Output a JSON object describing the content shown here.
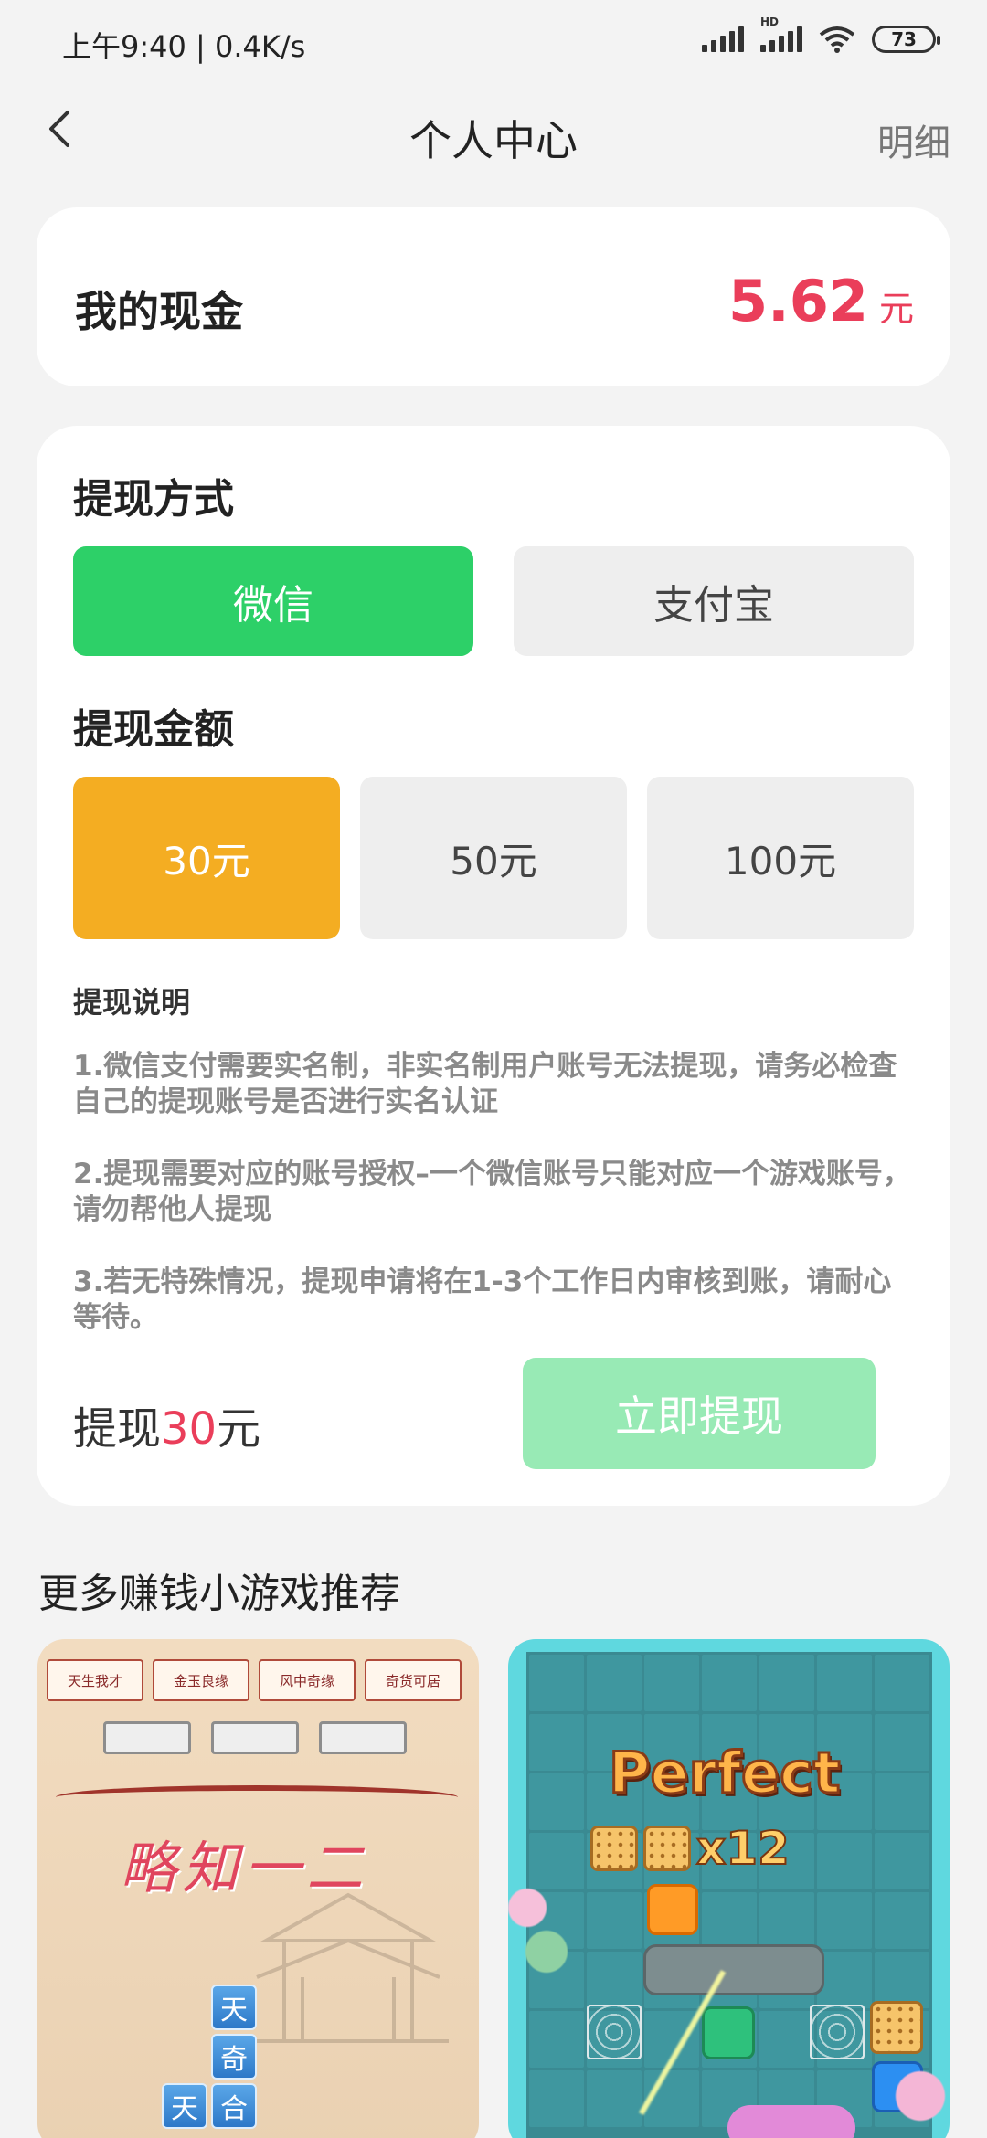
{
  "status_bar": {
    "time": "上午9:40 | 0.4K/s",
    "hd_label": "HD",
    "battery": "73"
  },
  "nav": {
    "title": "个人中心",
    "detail_link": "明细"
  },
  "cash": {
    "label": "我的现金",
    "amount": "5.62",
    "unit": "元"
  },
  "withdraw": {
    "method_title": "提现方式",
    "methods": [
      {
        "label": "微信",
        "selected": true
      },
      {
        "label": "支付宝",
        "selected": false
      }
    ],
    "amount_title": "提现金额",
    "amounts": [
      {
        "label": "30元",
        "selected": true
      },
      {
        "label": "50元",
        "selected": false
      },
      {
        "label": "100元",
        "selected": false
      }
    ],
    "desc_title": "提现说明",
    "descriptions": [
      "1.微信支付需要实名制，非实名制用户账号无法提现，请务必检查自己的提现账号是否进行实名认证",
      "2.提现需要对应的账号授权–一个微信账号只能对应一个游戏账号，请勿帮他人提现",
      "3.若无特殊情况，提现申请将在1-3个工作日内审核到账，请耐心等待。"
    ],
    "summary_prefix": "提现",
    "summary_amount": "30",
    "summary_suffix": "元",
    "submit_label": "立即提现"
  },
  "recommend": {
    "title": "更多赚钱小游戏推荐",
    "game1": {
      "tags": [
        "天生我才",
        "金玉良缘",
        "风中奇缘",
        "奇货可居"
      ],
      "logo_text": "略知一二",
      "tiles": [
        "天",
        "奇",
        "天",
        "合"
      ]
    },
    "game2": {
      "banner": "Perfect",
      "combo": "x12"
    }
  },
  "colors": {
    "accent_red": "#ea3e5a",
    "wechat_green": "#2dd068",
    "selected_amount": "#f4ad22",
    "submit_disabled": "#98eab5"
  }
}
